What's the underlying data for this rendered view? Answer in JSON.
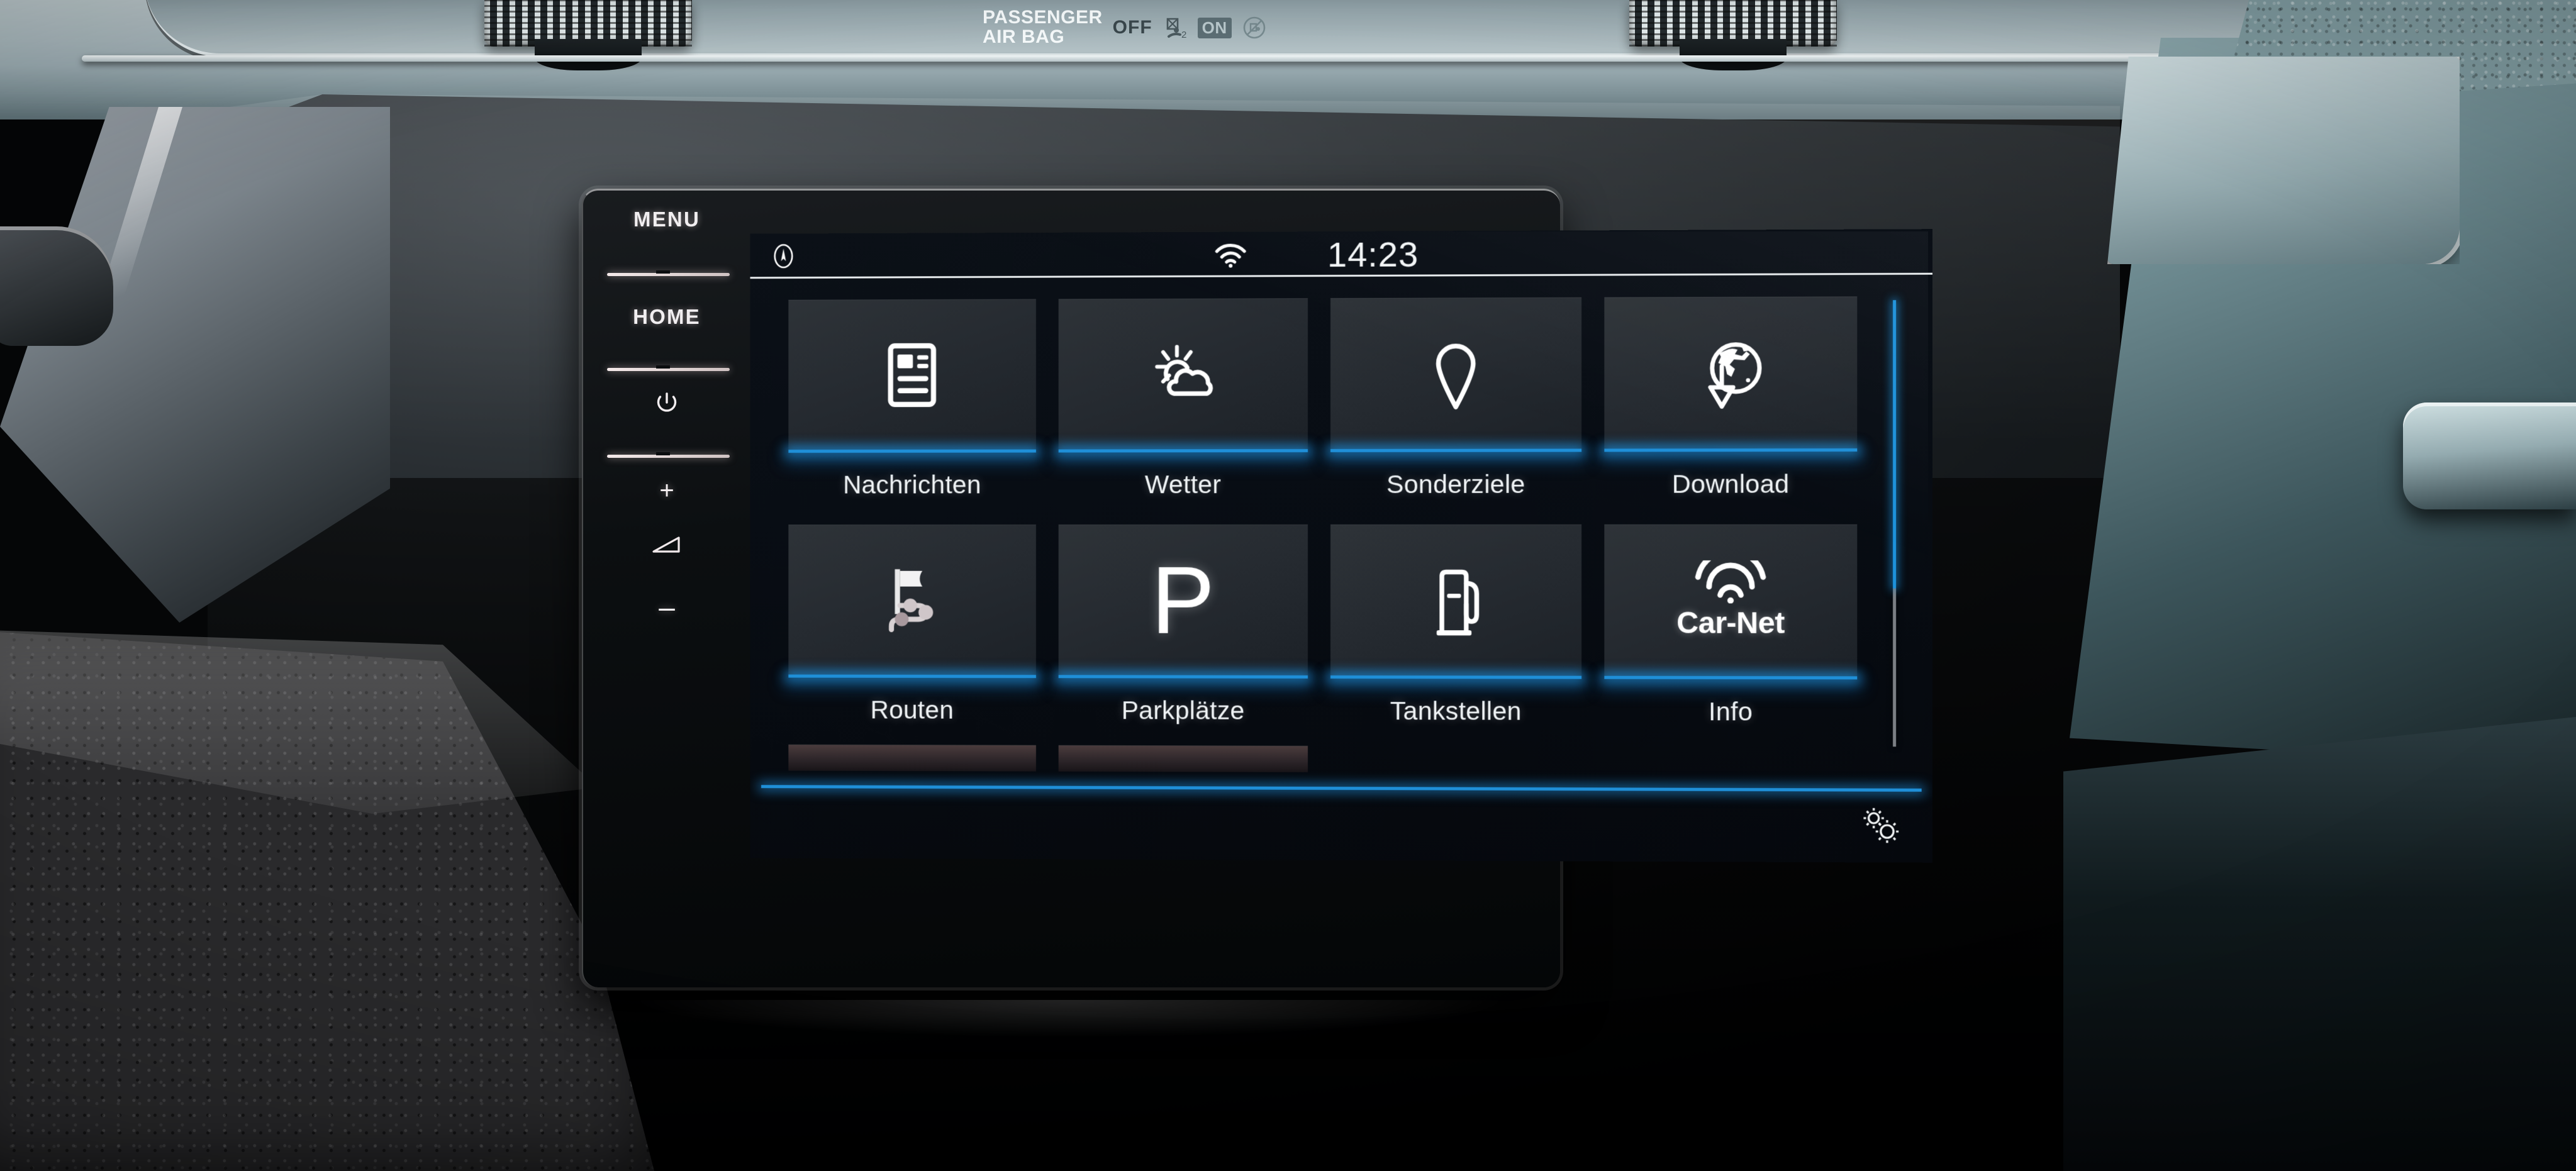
{
  "vehicle": {
    "airbag_indicator": {
      "title_line1": "PASSENGER",
      "title_line2": "AIR BAG",
      "off_label": "OFF",
      "on_label": "ON",
      "off_icon": "airbag-off-child-seat-icon",
      "on_icon": "airbag-on-no-child-seat-icon"
    },
    "dashboard_color": "#7e9197",
    "left_vent_icon": "air-vent-grille-icon",
    "right_vent_icon": "air-vent-grille-icon",
    "stalk_icon": "turn-signal-stalk-icon"
  },
  "head_unit": {
    "side_keys": [
      {
        "label": "MENU",
        "type": "text",
        "name": "menu-key"
      },
      {
        "label": "HOME",
        "type": "text",
        "name": "home-key"
      },
      {
        "label": "⏻",
        "type": "icon",
        "name": "power-key",
        "icon": "power-icon"
      },
      {
        "label": "+",
        "type": "icon",
        "name": "volume-up-key",
        "icon": "plus-icon"
      },
      {
        "label": "◸",
        "type": "icon",
        "name": "volume-icon",
        "icon": "volume-wedge-icon"
      },
      {
        "label": "–",
        "type": "icon",
        "name": "volume-down-key",
        "icon": "minus-icon"
      }
    ]
  },
  "screen": {
    "accent_color": "#1f8fd8",
    "background_color": "#080d14",
    "statusbar": {
      "nav_icon": "compass-needle-icon",
      "wifi_icon": "wifi-icon",
      "time": "14:23"
    },
    "tiles": [
      {
        "label": "Nachrichten",
        "icon": "news-article-icon",
        "name": "tile-nachrichten"
      },
      {
        "label": "Wetter",
        "icon": "sun-behind-cloud-icon",
        "name": "tile-wetter"
      },
      {
        "label": "Sonderziele",
        "icon": "map-pin-icon",
        "name": "tile-sonderziele"
      },
      {
        "label": "Download",
        "icon": "globe-download-icon",
        "name": "tile-download"
      },
      {
        "label": "Routen",
        "icon": "flag-route-icon",
        "name": "tile-routen"
      },
      {
        "label": "Parkplätze",
        "icon": "parking-p-icon",
        "name": "tile-parkplaetze"
      },
      {
        "label": "Tankstellen",
        "icon": "fuel-pump-icon",
        "name": "tile-tankstellen"
      },
      {
        "label": "Info",
        "icon": "car-net-wifi-icon",
        "name": "tile-info",
        "brand_text": "Car-Net"
      }
    ],
    "scrollbar": {
      "thumb_fraction": 0.645,
      "position": "right"
    },
    "footer": {
      "settings_icon": "gears-settings-icon"
    }
  }
}
